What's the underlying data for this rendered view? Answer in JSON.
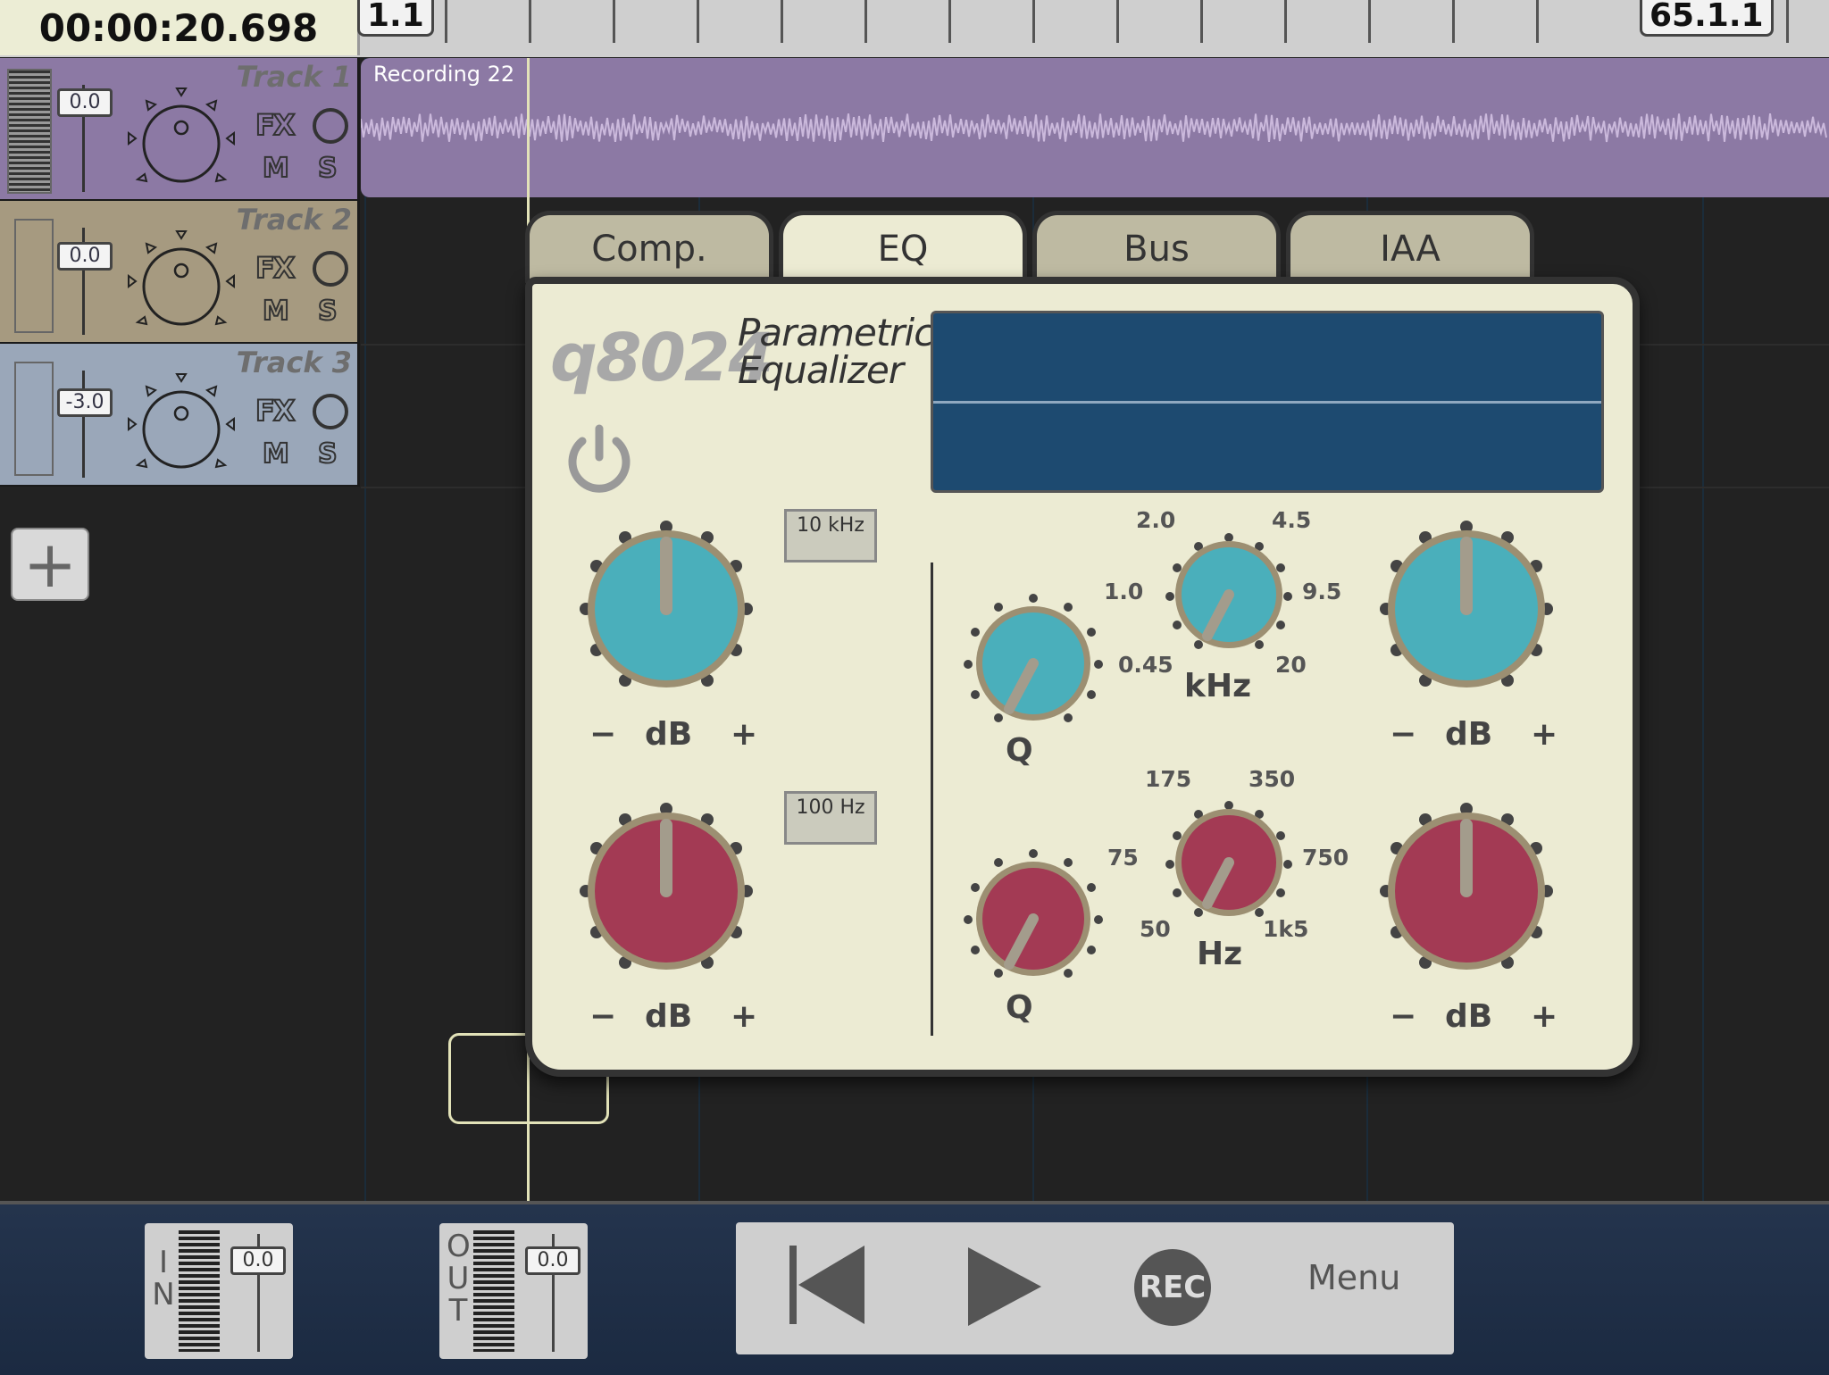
{
  "timecode": "00:00:20.698",
  "ruler": {
    "start_marker": "1.1",
    "end_marker": "65.1.1"
  },
  "tracks": [
    {
      "name": "Track 1",
      "volume": "0.0",
      "color": "#8c79a4",
      "fx": "FX",
      "mute": "M",
      "solo": "S"
    },
    {
      "name": "Track 2",
      "volume": "0.0",
      "color": "#a69a80",
      "fx": "FX",
      "mute": "M",
      "solo": "S"
    },
    {
      "name": "Track 3",
      "volume": "-3.0",
      "color": "#9aa7b9",
      "fx": "FX",
      "mute": "M",
      "solo": "S"
    }
  ],
  "region": {
    "title": "Recording 22",
    "color": "#8c79a4"
  },
  "add_track_icon": "plus-icon",
  "plugin": {
    "tabs": [
      "Comp.",
      "EQ",
      "Bus",
      "IAA"
    ],
    "active_tab": "EQ",
    "model": "q8024",
    "description_line1": "Parametric",
    "description_line2": "Equalizer",
    "high_shelf_freq": "10 kHz",
    "low_shelf_freq": "100 Hz",
    "db_label": "dB",
    "minus": "−",
    "plus": "+",
    "q_label": "Q",
    "khz_label": "kHz",
    "hz_label": "Hz",
    "high_mid_scale": [
      "2.0",
      "4.5",
      "1.0",
      "9.5",
      "0.45",
      "20"
    ],
    "low_mid_scale": [
      "175",
      "350",
      "75",
      "750",
      "50",
      "1k5"
    ],
    "colors": {
      "high": "#4aafbb",
      "low": "#a33a54",
      "panel": "#ecebd3",
      "display": "#1d4a70"
    }
  },
  "transport": {
    "in_letters": [
      "I",
      "N"
    ],
    "in_value": "0.0",
    "out_letters": [
      "O",
      "U",
      "T"
    ],
    "out_value": "0.0",
    "rec": "REC",
    "menu": "Menu"
  }
}
